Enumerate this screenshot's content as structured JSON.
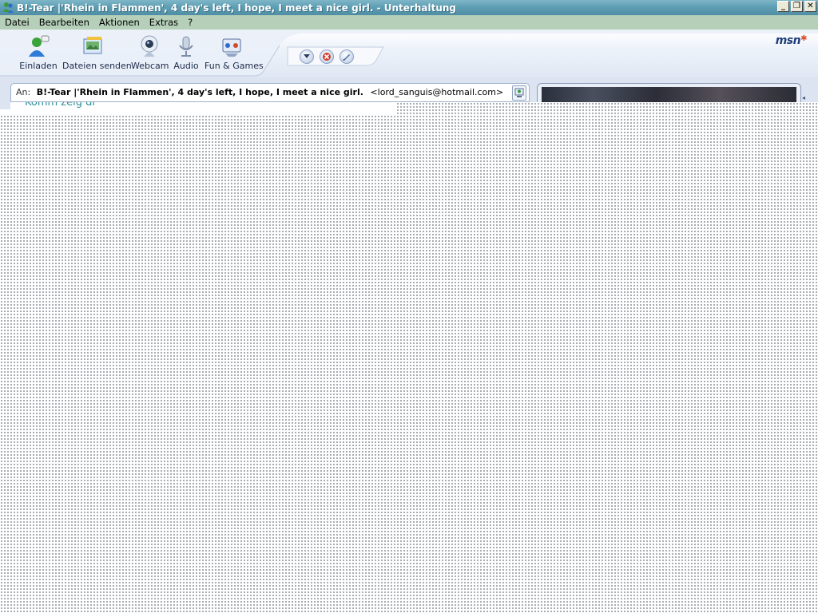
{
  "window": {
    "title": "B!-Tear |'Rhein in Flammen', 4 day's left, I hope, I meet a nice girl. - Unterhaltung",
    "controls": {
      "minimize": "_",
      "restore": "❐",
      "close": "✕"
    }
  },
  "menu": {
    "items": [
      "Datei",
      "Bearbeiten",
      "Aktionen",
      "Extras",
      "?"
    ]
  },
  "toolbar": {
    "buttons": [
      {
        "label": "Einladen",
        "icon": "invite-buddy-icon"
      },
      {
        "label": "Dateien senden",
        "icon": "send-files-icon"
      },
      {
        "label": "Webcam",
        "icon": "webcam-icon"
      },
      {
        "label": "Audio",
        "icon": "microphone-icon"
      },
      {
        "label": "Fun & Games",
        "icon": "fun-games-icon"
      }
    ],
    "round_buttons": [
      "more-dropdown-icon",
      "block-icon",
      "edit-icon"
    ],
    "logo": "msn"
  },
  "conversation": {
    "to_label": "An:",
    "contact_name": "B!-Tear |'Rhein in Flammen', 4 day's left, I hope, I meet a nice girl.",
    "contact_email": "<lord_sanguis@hotmail.com>",
    "peek_text": "Komm zeig dr"
  },
  "colors": {
    "titlebar": "#5f9fb4",
    "menubar": "#b5cfb8",
    "toolbar_bg": "#dfe7f3",
    "accent": "#1f3d7a"
  }
}
